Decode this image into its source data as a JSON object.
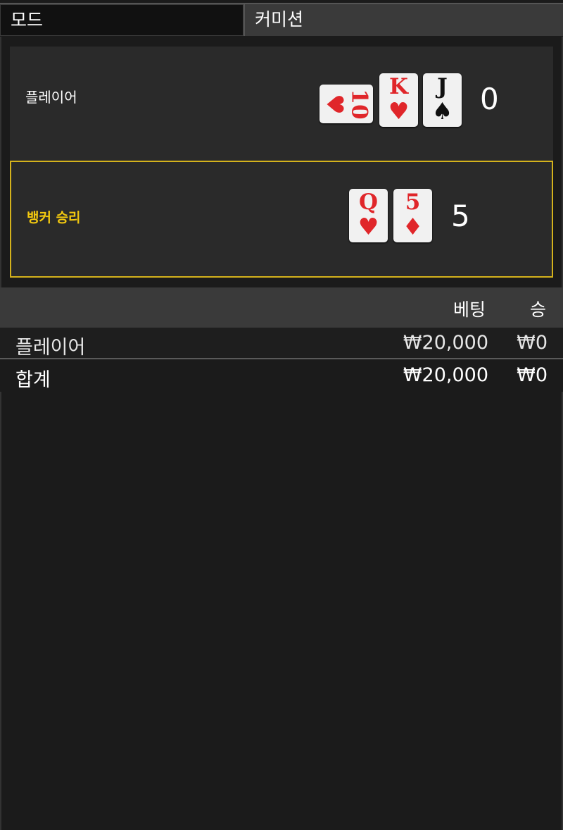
{
  "mode": {
    "label": "모드",
    "value": "커미션"
  },
  "player": {
    "label": "플레이어",
    "score": "0",
    "cards": [
      {
        "rank": "10",
        "suit": "♥",
        "color": "red",
        "rotated": true
      },
      {
        "rank": "K",
        "suit": "♥",
        "color": "red"
      },
      {
        "rank": "J",
        "suit": "♠",
        "color": "black"
      }
    ]
  },
  "banker": {
    "label": "뱅커 승리",
    "score": "5",
    "cards": [
      {
        "rank": "Q",
        "suit": "♥",
        "color": "red"
      },
      {
        "rank": "5",
        "suit": "♦",
        "color": "red"
      }
    ]
  },
  "table": {
    "headers": {
      "bet": "베팅",
      "win": "승"
    },
    "rows": [
      {
        "name": "플레이어",
        "bet": "₩20,000",
        "win": "₩0"
      },
      {
        "name": "합계",
        "bet": "₩20,000",
        "win": "₩0"
      }
    ]
  },
  "colors": {
    "accent": "#d4b21c",
    "banker_label": "#f2c80f",
    "card_red": "#e0262a"
  }
}
